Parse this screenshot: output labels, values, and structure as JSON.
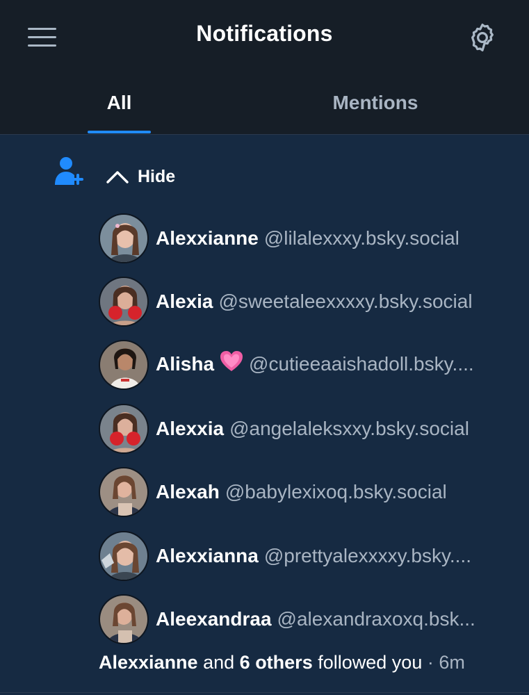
{
  "header": {
    "title": "Notifications",
    "menu_icon": "hamburger-menu-icon",
    "settings_icon": "gear-icon"
  },
  "tabs": [
    {
      "label": "All",
      "active": true
    },
    {
      "label": "Mentions",
      "active": false
    }
  ],
  "notification": {
    "icon": "person-add-icon",
    "toggle_label": "Hide",
    "toggle_icon": "chevron-up-icon",
    "followers": [
      {
        "name": "Alexxianne",
        "handle": "@lilalexxxy.bsky.social",
        "emoji": ""
      },
      {
        "name": "Alexia",
        "handle": "@sweetaleexxxxy.bsky.social",
        "emoji": ""
      },
      {
        "name": "Alisha",
        "handle": "@cutieeaaishadoll.bsky....",
        "emoji": "💗"
      },
      {
        "name": "Alexxia",
        "handle": "@angelaleksxxy.bsky.social",
        "emoji": ""
      },
      {
        "name": "Alexah",
        "handle": "@babylexixoq.bsky.social",
        "emoji": ""
      },
      {
        "name": "Alexxianna",
        "handle": "@prettyalexxxxy.bsky....",
        "emoji": ""
      },
      {
        "name": "Aleexandraa",
        "handle": "@alexandraxoxq.bsk...",
        "emoji": ""
      }
    ],
    "summary": {
      "first_name": "Alexxianne",
      "and": "and",
      "others": "6 others",
      "action": "followed you",
      "separator": "·",
      "time": "6m"
    }
  },
  "colors": {
    "header_bg": "#161e27",
    "content_bg": "#162a42",
    "accent": "#208bfe",
    "muted_text": "#a9b5c3"
  }
}
